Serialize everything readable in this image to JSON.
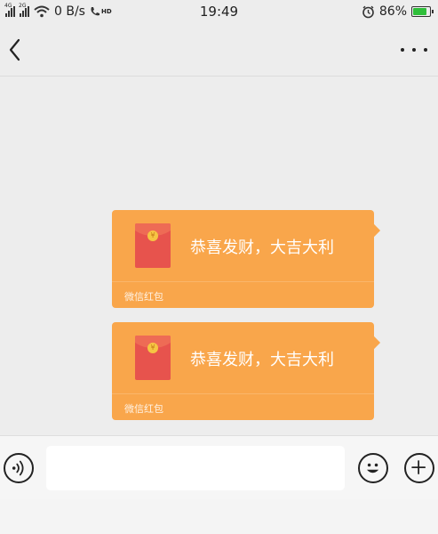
{
  "status_bar": {
    "signal_1_label": "4G",
    "signal_2_label": "2G",
    "network_speed": "0 B/s",
    "call_label": "HD",
    "time": "19:49",
    "battery_percent": "86%",
    "battery_level": 0.86,
    "battery_color": "#2fbf3a"
  },
  "nav": {
    "back_icon": "chevron-left-icon",
    "more_icon": "more-horizontal-icon"
  },
  "messages": [
    {
      "type": "red-packet",
      "greeting": "恭喜发财，大吉大利",
      "label": "微信红包"
    },
    {
      "type": "red-packet",
      "greeting": "恭喜发财，大吉大利",
      "label": "微信红包"
    }
  ],
  "colors": {
    "red_packet_bg": "#f9a64b",
    "red_packet_envelope": "#e7534d",
    "chat_bg": "#ededed"
  },
  "input_bar": {
    "voice_icon": "voice-icon",
    "emoji_icon": "emoji-icon",
    "plus_icon": "plus-icon",
    "text_value": ""
  }
}
